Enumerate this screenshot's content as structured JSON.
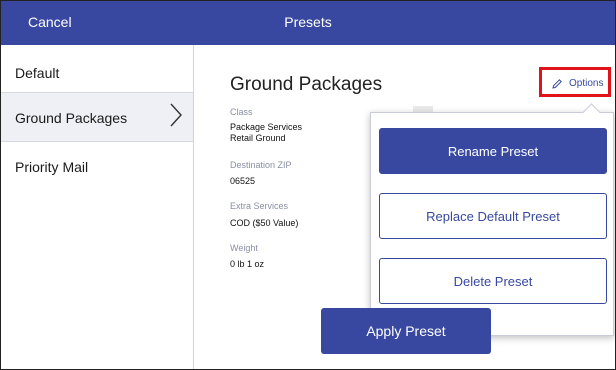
{
  "header": {
    "cancel_label": "Cancel",
    "title": "Presets"
  },
  "sidebar": {
    "items": [
      {
        "label": "Default"
      },
      {
        "label": "Ground Packages",
        "selected": true
      },
      {
        "label": "Priority Mail"
      }
    ]
  },
  "preset": {
    "title": "Ground Packages",
    "class_label": "Class",
    "class_value_line1": "Package Services",
    "class_value_line2": "Retail Ground",
    "destination_label": "Destination ZIP",
    "destination_value": "06525",
    "extra_services_label": "Extra Services",
    "extra_services_value": "COD ($50 Value)",
    "weight_label": "Weight",
    "weight_value": "0 lb 1 oz"
  },
  "options_button": {
    "label": "Options",
    "icon": "pencil-icon"
  },
  "options_menu": {
    "items": [
      {
        "label": "Rename Preset"
      },
      {
        "label": "Replace Default Preset"
      },
      {
        "label": "Delete Preset"
      }
    ]
  },
  "apply_button": {
    "label": "Apply Preset"
  },
  "colors": {
    "brand": "#3848a0",
    "highlight_border": "#e0121a",
    "selected_row": "#eef0f6"
  }
}
